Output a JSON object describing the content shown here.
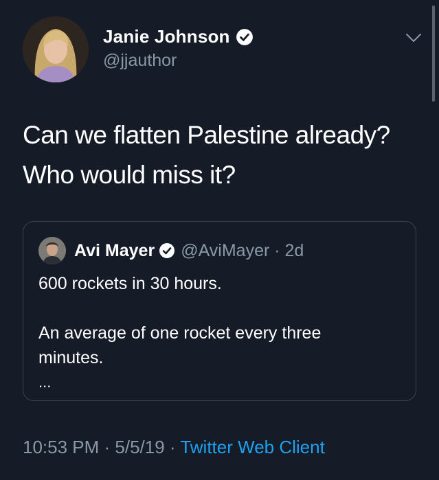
{
  "author": {
    "name": "Janie Johnson",
    "handle": "@jjauthor",
    "verified_icon": "verified-badge-icon",
    "menu_icon": "chevron-down-icon"
  },
  "tweet": {
    "lines": [
      "Can we flatten Palestine already?",
      "Who would miss it?"
    ]
  },
  "quoted_tweet": {
    "name": "Avi Mayer",
    "handle": "@AviMayer · 2d",
    "lines": [
      "600 rockets in 30 hours.",
      "An average of one rocket every three",
      "minutes."
    ],
    "ellipsis": "..."
  },
  "footer": {
    "time_date": "10:53 PM · 5/5/19 · ",
    "client": "Twitter Web Client"
  },
  "colors": {
    "background": "#151c27",
    "text": "#ffffff",
    "secondary": "#8899a6",
    "link": "#1da1f2",
    "border": "#38444d"
  }
}
